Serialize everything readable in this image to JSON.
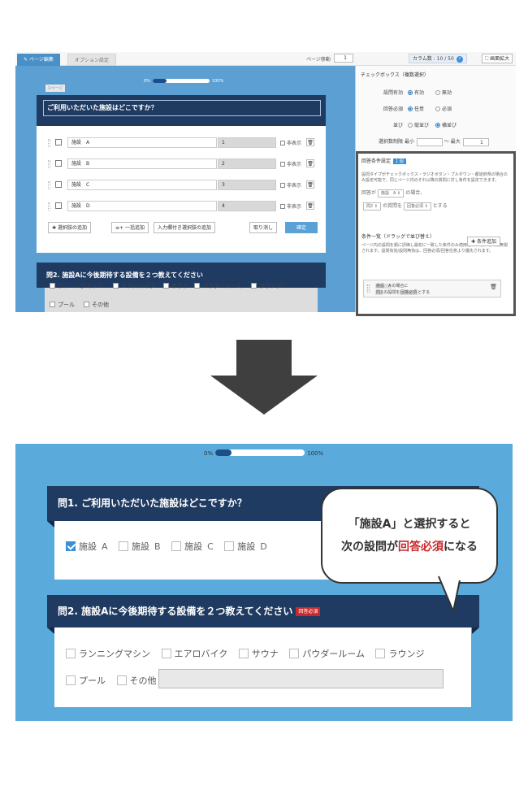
{
  "editor": {
    "tabs": [
      "ページ編集",
      "オプション設定"
    ],
    "page_move_label": "ページ移動",
    "page_move_value": "1",
    "column_count": "カラム数 : 10 / 50",
    "expand_label": "画面拡大",
    "progress": {
      "start": "0%",
      "end": "100%",
      "fraction": 0.25
    },
    "page_label": "1ページ",
    "q1_title": "ご利用いただいた施設はどこですか？",
    "choices": [
      {
        "name": "施設　A",
        "value": "1"
      },
      {
        "name": "施設　B",
        "value": "2"
      },
      {
        "name": "施設　C",
        "value": "3"
      },
      {
        "name": "施設　D",
        "value": "4"
      }
    ],
    "hide_label": "非表示",
    "buttons": {
      "add_choice": "選択肢の追加",
      "bulk_add": "一括追加",
      "add_with_input": "入力欄付き選択肢の追加",
      "cancel": "取り消し",
      "confirm": "確定"
    },
    "q2_title": "問2. 施設Aに今後期待する設備を２つ教えてください",
    "q2_options": [
      "ランニングマシン",
      "エアロバイク",
      "サウナ",
      "パウダールーム",
      "ラウンジ",
      "プール",
      "その他"
    ]
  },
  "settings": {
    "title": "チェックボックス（複数選択）",
    "question_enabled": {
      "label": "設問有効",
      "on": "有効",
      "off": "無効"
    },
    "answer_required": {
      "label": "回答必須",
      "on": "任意",
      "off": "必須"
    },
    "layout": {
      "label": "並び",
      "vertical": "縦並び",
      "horizontal": "横並び"
    },
    "select_limit": {
      "label": "選択数制限",
      "min": "最小",
      "max": "～ 最大",
      "max_value": "1"
    }
  },
  "condition": {
    "title": "回答条件設定",
    "count": "1 個",
    "description": "設問タイプがチェックボックス・ラジオボタン・プルダウン・都道府県の場合のみ設定可能で、同じページ内のそれ以降の質問に対し条件を設定できます。",
    "answer_label": "回答が",
    "answer_value": "施設　A",
    "case_label": "の場合、",
    "target_question": "問2",
    "target_suffix": "の質問を",
    "target_state": "回答必須",
    "action_suffix": "とする",
    "add_button": "条件追加",
    "list_title": "条件一覧（ドラッグで並び替え）",
    "list_description": "ページ内の設問を順に評価し最初に一致した条件のみ適用され、それ以降は無視されます。設問有効/設問無効は、回答必須/回答任意より優先されます。",
    "item_line1_a": "施設　A",
    "item_line1_b": "の場合に",
    "item_line2_a": "問2",
    "item_line2_b": "の設問を",
    "item_line2_c": "回答必須",
    "item_line2_d": "とする"
  },
  "preview": {
    "progress": {
      "start": "0%",
      "end": "100%",
      "fraction": 0.18
    },
    "q1_title": "問1. ご利用いただいた施設はどこですか？",
    "q1_options": [
      {
        "name": "施設",
        "letter": "A",
        "checked": true
      },
      {
        "name": "施設",
        "letter": "B",
        "checked": false
      },
      {
        "name": "施設",
        "letter": "C",
        "checked": false
      },
      {
        "name": "施設",
        "letter": "D",
        "checked": false
      }
    ],
    "q2_title": "問2. 施設Aに今後期待する設備を２つ教えてください",
    "required_badge": "回答必須",
    "q2_options": [
      "ランニングマシン",
      "エアロバイク",
      "サウナ",
      "パウダールーム",
      "ラウンジ",
      "プール",
      "その他"
    ]
  },
  "callout": {
    "line1_a": "「施設A」",
    "line1_b": "と選択すると",
    "line2_a": "次の設問が",
    "line2_red": "回答必須",
    "line2_b": "になる"
  },
  "colors": {
    "navy": "#1f3b62",
    "accent_blue": "#3b8fd6",
    "required_red": "#c8282c",
    "preview_bg": "#5aaadc"
  }
}
